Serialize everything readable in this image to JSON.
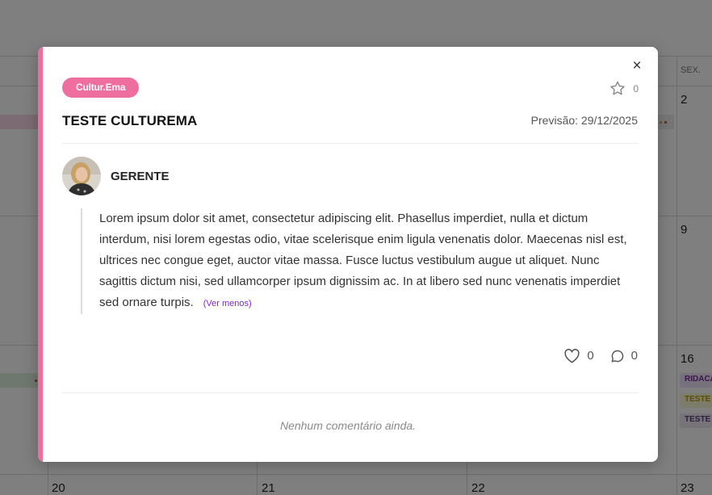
{
  "calendar": {
    "day_header": "SEX.",
    "day_numbers": [
      "2",
      "9",
      "16",
      "20",
      "21",
      "22",
      "23"
    ],
    "events": [
      "RIDACA",
      "TESTE",
      "TESTE"
    ]
  },
  "modal": {
    "accent_color": "#ee6f9f",
    "tag": "Cultur.Ema",
    "favorite_count": "0",
    "title": "TESTE CULTUREMA",
    "forecast": "Previsão: 29/12/2025",
    "author": "GERENTE",
    "body": "Lorem ipsum dolor sit amet, consectetur adipiscing elit. Phasellus imperdiet, nulla et dictum interdum, nisi lorem egestas odio, vitae scelerisque enim ligula venenatis dolor. Maecenas nisl est, ultrices nec congue eget, auctor vitae massa. Fusce luctus vestibulum augue ut aliquet. Nunc sagittis dictum nisi, sed ullamcorper ipsum dignissim ac. In at libero sed nunc venenatis imperdiet sed ornare turpis.",
    "ver_menos": "(Ver menos)",
    "likes": "0",
    "comments": "0",
    "empty_comments": "Nenhum comentário ainda."
  },
  "icons": [
    "close-icon",
    "star-icon",
    "heart-icon",
    "comment-icon"
  ]
}
